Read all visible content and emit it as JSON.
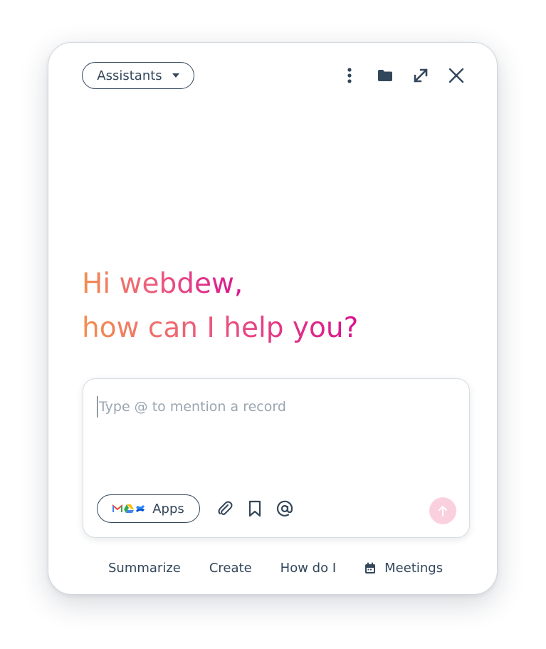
{
  "header": {
    "assistants_label": "Assistants",
    "icons": [
      "more-vertical-icon",
      "folder-icon",
      "expand-icon",
      "close-icon"
    ]
  },
  "greeting": {
    "line1": "Hi webdew,",
    "line2": "how can I help you?",
    "gradient_colors": [
      "#f38f4f",
      "#ec5b7e",
      "#d9128f"
    ]
  },
  "composer": {
    "placeholder": "Type @ to mention a record",
    "value": "",
    "apps_label": "Apps",
    "app_logos": [
      "gmail-icon",
      "google-drive-icon",
      "confluence-icon"
    ],
    "tools": [
      "attachment-icon",
      "bookmark-icon",
      "mention-icon"
    ],
    "send_icon": "arrow-up-icon"
  },
  "suggestions": [
    {
      "label": "Summarize"
    },
    {
      "label": "Create"
    },
    {
      "label": "How do I"
    },
    {
      "label": "Meetings",
      "icon": "calendar-icon"
    }
  ],
  "colors": {
    "text": "#33475b",
    "border": "#cfd6de",
    "send_button": "#fbd0de"
  }
}
